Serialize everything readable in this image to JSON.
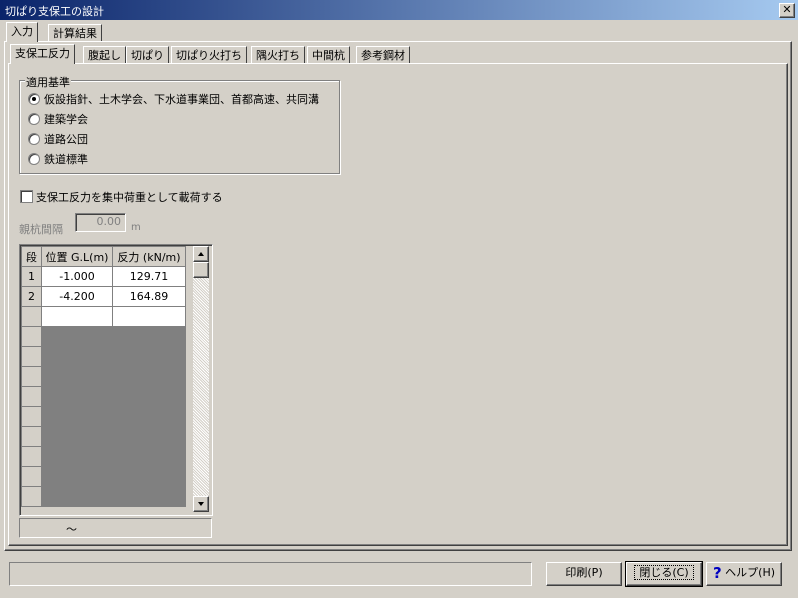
{
  "window": {
    "title": "切ぱり支保工の設計",
    "close_glyph": "✕"
  },
  "outer_tabs": [
    {
      "label": "入力"
    },
    {
      "label": "計算結果"
    }
  ],
  "inner_tabs": [
    {
      "label": "支保工反力"
    },
    {
      "label": "腹起し"
    },
    {
      "label": "切ぱり"
    },
    {
      "label": "切ぱり火打ち"
    },
    {
      "label": "隅火打ち"
    },
    {
      "label": "中間杭"
    },
    {
      "label": "参考鋼材"
    }
  ],
  "standard_group": {
    "legend": "適用基準",
    "options": [
      {
        "label": "仮設指針、土木学会、下水道事業団、首都高速、共同溝",
        "selected": true
      },
      {
        "label": "建築学会",
        "selected": false
      },
      {
        "label": "道路公団",
        "selected": false
      },
      {
        "label": "鉄道標準",
        "selected": false
      }
    ]
  },
  "concentrated_load_checkbox": {
    "label": "支保工反力を集中荷重として載荷する",
    "checked": false
  },
  "pile_spacing": {
    "label": "親杭間隔",
    "value": "0.00",
    "unit": "m"
  },
  "table": {
    "headers": {
      "row": "段",
      "position": "位置 G.L(m)",
      "reaction": "反力 (kN/m)"
    },
    "rows": [
      {
        "index": "1",
        "position": "-1.000",
        "reaction": "129.71"
      },
      {
        "index": "2",
        "position": "-4.200",
        "reaction": "164.89"
      }
    ]
  },
  "range_indicator": "～",
  "buttons": {
    "print": "印刷(P)",
    "close": "閉じる(C)",
    "help": "ヘルプ(H)"
  },
  "icons": {
    "help": "question-icon",
    "scroll_up": "arrow-up-icon",
    "scroll_down": "arrow-down-icon"
  },
  "colors": {
    "title_start": "#0a246a",
    "title_end": "#a6caf0",
    "face": "#d4d0c8",
    "dark_cell": "#808080",
    "help_icon": "#0000c0"
  }
}
